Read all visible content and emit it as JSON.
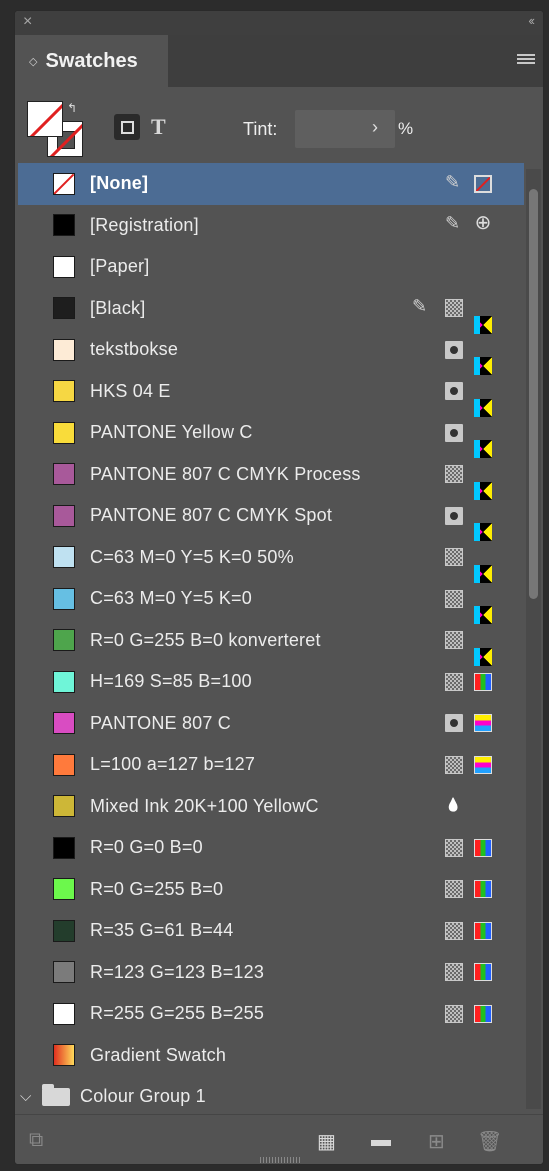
{
  "panel": {
    "title": "Swatches",
    "tint_label": "Tint:",
    "tint_value": "",
    "tint_unit": "%",
    "format_text_label": "T"
  },
  "swatches": [
    {
      "name": "[None]",
      "chip": "none",
      "icons": [
        "pencil-crossed",
        "none"
      ],
      "selected": true
    },
    {
      "name": "[Registration]",
      "chip": "#000000",
      "icons": [
        "pencil-crossed",
        "registration"
      ]
    },
    {
      "name": "[Paper]",
      "chip": "#ffffff",
      "icons": []
    },
    {
      "name": "[Black]",
      "chip": "#1e1e1e",
      "icons": [
        "pencil-crossed",
        "process",
        "cmyk"
      ]
    },
    {
      "name": "tekstbokse",
      "chip": "#fdebd6",
      "icons": [
        "spot",
        "cmyk"
      ]
    },
    {
      "name": "HKS 04 E",
      "chip": "#f6d743",
      "icons": [
        "spot",
        "cmyk"
      ]
    },
    {
      "name": "PANTONE Yellow C",
      "chip": "#f9dc3a",
      "icons": [
        "spot",
        "cmyk"
      ]
    },
    {
      "name": "PANTONE 807 C CMYK Process",
      "chip": "#a8599a",
      "icons": [
        "process",
        "cmyk"
      ]
    },
    {
      "name": "PANTONE 807 C CMYK Spot",
      "chip": "#a8599a",
      "icons": [
        "spot",
        "cmyk"
      ]
    },
    {
      "name": "C=63 M=0 Y=5 K=0 50%",
      "chip": "#bfe1f1",
      "icons": [
        "process",
        "cmyk"
      ]
    },
    {
      "name": "C=63 M=0 Y=5 K=0",
      "chip": "#66bfe3",
      "icons": [
        "process",
        "cmyk"
      ]
    },
    {
      "name": "R=0 G=255 B=0 konverteret",
      "chip": "#4ea54c",
      "icons": [
        "process",
        "cmyk"
      ]
    },
    {
      "name": "H=169 S=85 B=100",
      "chip": "#6ff5d8",
      "icons": [
        "process",
        "rgb"
      ]
    },
    {
      "name": "PANTONE 807 C",
      "chip": "#d94cc2",
      "icons": [
        "spot",
        "lab"
      ]
    },
    {
      "name": "L=100 a=127 b=127",
      "chip": "#ff7a3c",
      "icons": [
        "process",
        "lab"
      ]
    },
    {
      "name": "Mixed Ink 20K+100 YellowC",
      "chip": "#cdb737",
      "icons": [
        "mixed-ink"
      ]
    },
    {
      "name": "R=0 G=0 B=0",
      "chip": "#000000",
      "icons": [
        "process",
        "rgb"
      ]
    },
    {
      "name": "R=0 G=255 B=0",
      "chip": "#6cf84c",
      "icons": [
        "process",
        "rgb"
      ]
    },
    {
      "name": "R=35 G=61 B=44",
      "chip": "#233d2c",
      "icons": [
        "process",
        "rgb"
      ]
    },
    {
      "name": "R=123 G=123 B=123",
      "chip": "#7b7b7b",
      "icons": [
        "process",
        "rgb"
      ]
    },
    {
      "name": "R=255 G=255 B=255",
      "chip": "#ffffff",
      "icons": [
        "process",
        "rgb"
      ]
    },
    {
      "name": "Gradient Swatch",
      "chip": "gradient",
      "icons": []
    }
  ],
  "group": {
    "name": "Colour Group 1"
  },
  "colors": {
    "panel_bg": "#535353",
    "selection": "#4c6c94",
    "stroke_red": "#e02020"
  }
}
